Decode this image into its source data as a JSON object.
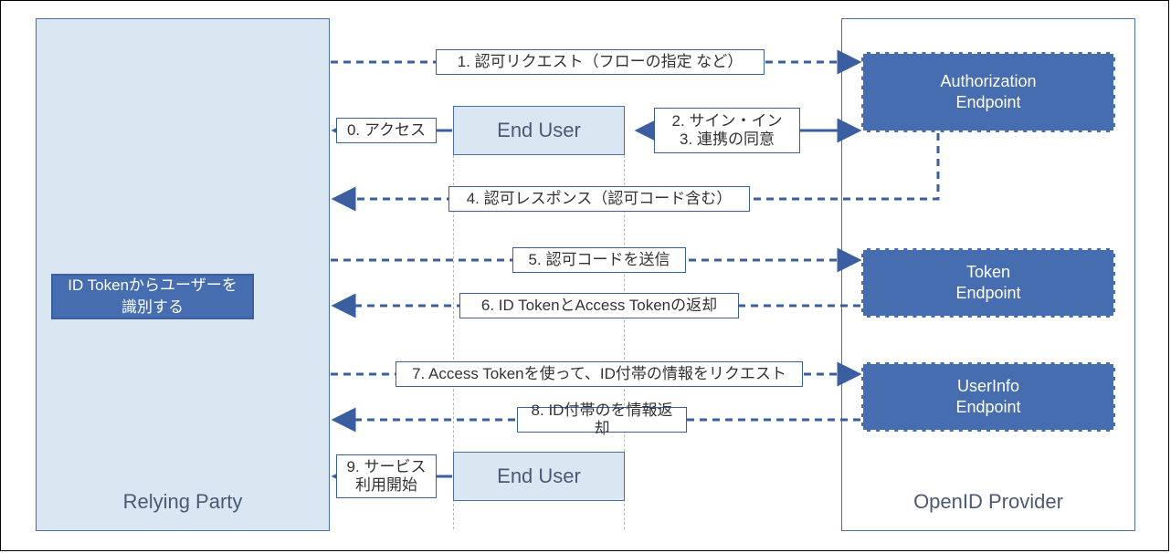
{
  "relyingParty": {
    "label": "Relying Party"
  },
  "openIdProvider": {
    "label": "OpenID Provider"
  },
  "endUser1": {
    "label": "End User"
  },
  "endUser2": {
    "label": "End User"
  },
  "endpoints": {
    "authorization": "Authorization\nEndpoint",
    "token": "Token\nEndpoint",
    "userinfo": "UserInfo\nEndpoint"
  },
  "note": "ID Tokenからユーザーを\n識別する",
  "steps": {
    "s0": "0. アクセス",
    "s1": "1. 認可リクエスト（フローの指定 など）",
    "s2_3": "2. サイン・イン\n3. 連携の同意",
    "s4": "4. 認可レスポンス（認可コード含む）",
    "s5": "5. 認可コードを送信",
    "s6": "6. ID TokenとAccess Tokenの返却",
    "s7": "7. Access Tokenを使って、ID付帯の情報をリクエスト",
    "s8": "8. ID付帯のを情報返却",
    "s9": "9. サービス\n利用開始"
  },
  "colors": {
    "blue": "#3a5ea0",
    "fillBlue": "#466daf",
    "paleBlue": "#dae7f3"
  }
}
